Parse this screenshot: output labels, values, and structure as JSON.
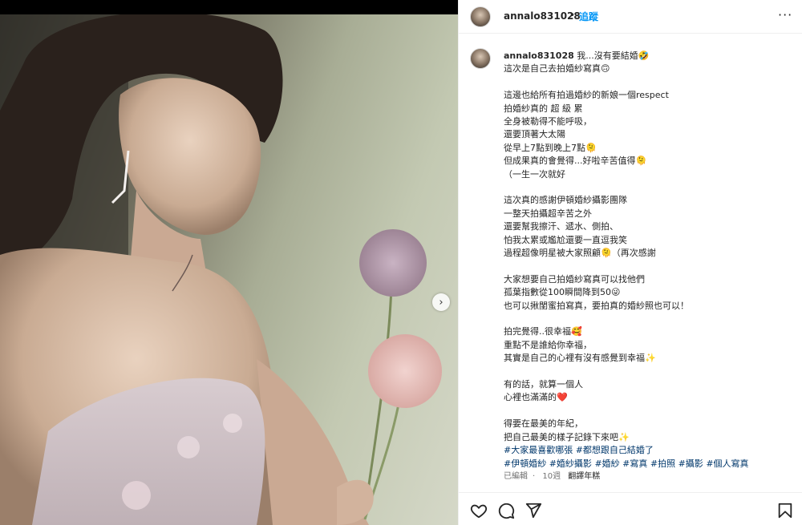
{
  "post": {
    "username": "annalo831028",
    "dot": "•",
    "follow_label": "追蹤",
    "more_icon": "more-horizontal-icon"
  },
  "caption": {
    "username": "annalo831028",
    "lines": [
      "我...沒有要結婚🤣",
      "這次是自己去拍婚紗寫真🙃",
      "",
      "這邊也給所有拍過婚紗的新娘一個respect",
      "拍婚紗真的 超 級 累",
      "全身被勒得不能呼吸，",
      "還要頂著大太陽",
      "從早上7點到晚上7點🫠",
      "但成果真的會覺得...好啦辛苦值得🫠",
      "（一生一次就好",
      "",
      "這次真的感謝伊頓婚紗攝影團隊",
      "一整天拍攝超辛苦之外",
      "還要幫我擦汗、遞水、側拍、",
      "怕我太累或尷尬還要一直逗我笑",
      "過程超像明星被大家照顧🫠（再次感謝",
      "",
      "大家想要自己拍婚紗寫真可以找他們",
      "孤葉指數從100瞬間降到50😜",
      "也可以揪閨蜜拍寫真，要拍真的婚紗照也可以！",
      "",
      "拍完覺得..很幸福🥰",
      "重點不是誰給你幸福，",
      "其實是自己的心裡有沒有感覺到幸福✨",
      "",
      "有的話，就算一個人",
      "心裡也滿滿的❤️",
      "",
      "得要在最美的年紀，",
      "把自己最美的樣子記錄下來吧✨"
    ],
    "hashtag_lines": [
      [
        "#大家最喜歡哪張",
        "#都想跟自己結婚了"
      ],
      [
        "#伊頓婚紗",
        "#婚紗攝影",
        "#婚紗",
        "#寫真",
        "#拍照",
        "#攝影",
        "#個人寫真"
      ]
    ],
    "edited_label": "已編輯",
    "time_ago": "10週",
    "translate_label": "翻譯年糕"
  },
  "actions": {
    "like_icon": "heart-icon",
    "comment_icon": "comment-icon",
    "share_icon": "share-icon",
    "save_icon": "bookmark-icon"
  },
  "carousel": {
    "next_icon": "chevron-right-icon"
  }
}
